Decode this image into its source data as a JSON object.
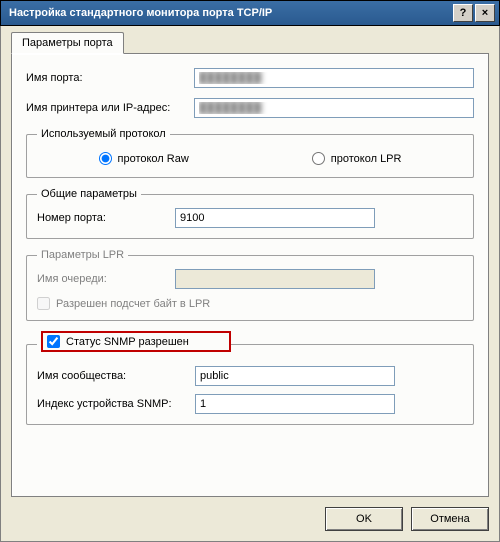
{
  "window": {
    "title": "Настройка стандартного монитора порта TCP/IP",
    "help": "?",
    "close": "×"
  },
  "tab": {
    "label": "Параметры порта"
  },
  "port_name": {
    "label": "Имя порта:",
    "value": "████████"
  },
  "printer_addr": {
    "label": "Имя принтера или IP-адрес:",
    "value": "████████"
  },
  "protocol": {
    "legend": "Используемый протокол",
    "raw": "протокол Raw",
    "lpr": "протокол LPR",
    "selected": "raw"
  },
  "general": {
    "legend": "Общие параметры",
    "port_number_label": "Номер порта:",
    "port_number_value": "9100"
  },
  "lpr": {
    "legend": "Параметры LPR",
    "queue_label": "Имя очереди:",
    "queue_value": "",
    "bytecount_label": "Разрешен подсчет байт в LPR"
  },
  "snmp": {
    "enable_label": "Статус SNMP разрешен",
    "community_label": "Имя сообщества:",
    "community_value": "public",
    "index_label": "Индекс устройства SNMP:",
    "index_value": "1"
  },
  "buttons": {
    "ok": "OK",
    "cancel": "Отмена"
  }
}
